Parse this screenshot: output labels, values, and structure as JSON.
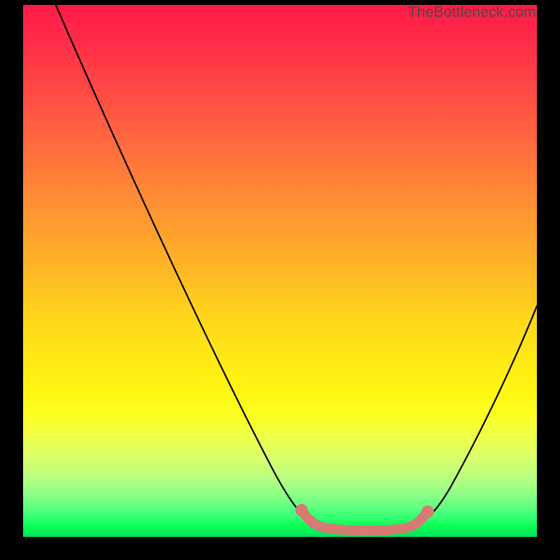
{
  "watermark": "TheBottleneck.com",
  "chart_data": {
    "type": "line",
    "title": "",
    "xlabel": "",
    "ylabel": "",
    "xlim": [
      0,
      100
    ],
    "ylim": [
      0,
      100
    ],
    "series": [
      {
        "name": "bottleneck-curve",
        "x": [
          0,
          3,
          6,
          9,
          12,
          15,
          18,
          21,
          24,
          27,
          30,
          33,
          36,
          39,
          42,
          45,
          48,
          51,
          53,
          55,
          57,
          59,
          61,
          63,
          66,
          69,
          72,
          75,
          78,
          81,
          84,
          87,
          90,
          93,
          96,
          99,
          100
        ],
        "y": [
          103,
          98,
          93,
          88,
          83,
          78,
          73,
          68,
          63,
          58,
          53,
          48,
          43,
          37,
          32,
          26,
          20,
          14,
          9,
          6,
          4,
          2.2,
          1.4,
          1.1,
          1.0,
          1.0,
          1.1,
          1.5,
          2.2,
          3.6,
          6.5,
          11,
          17,
          25,
          34,
          44,
          48
        ]
      }
    ],
    "highlight": {
      "name": "flat-bottom-marker",
      "color": "#d77a74",
      "segments": [
        {
          "x": [
            53,
            75.5
          ],
          "y": [
            2.2,
            2.2
          ]
        }
      ],
      "dots": [
        {
          "x": 53,
          "y": 4.0
        },
        {
          "x": 78.5,
          "y": 4.0
        }
      ]
    },
    "background_gradient": {
      "top": "#ff1a47",
      "mid": "#ffe816",
      "bottom": "#00e060"
    }
  }
}
